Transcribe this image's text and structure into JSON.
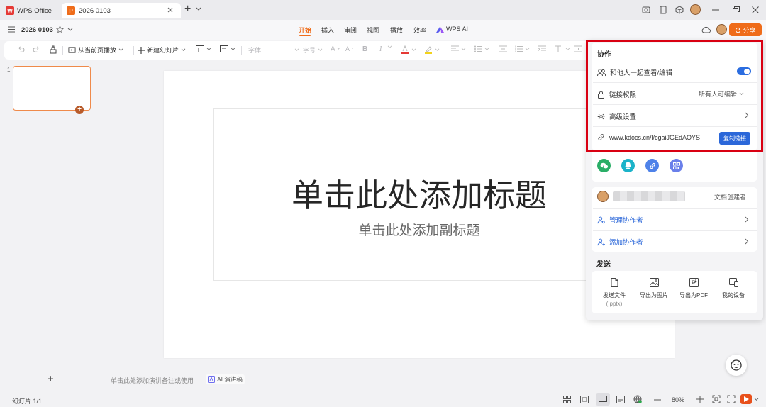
{
  "titlebar": {
    "app_tab": "WPS Office",
    "doc_tab": "2026 0103",
    "add_tab": "+",
    "app_logo": "W",
    "doc_logo": "P"
  },
  "menubar": {
    "doc_name": "2026 0103",
    "tabs": [
      "开始",
      "插入",
      "审阅",
      "视图",
      "播放",
      "效率",
      "WPS AI"
    ],
    "share_button": "分享"
  },
  "toolbar": {
    "play_from_current": "从当前页播放",
    "new_slide": "新建幻灯片",
    "font_placeholder": "字体",
    "font_size_placeholder": "字号"
  },
  "slides_panel": {
    "slide_number": "1",
    "add_slide": "+"
  },
  "slide": {
    "title_placeholder": "单击此处添加标题",
    "subtitle_placeholder": "单击此处添加副标题"
  },
  "notes": {
    "placeholder": "单击此处添加演讲备注或使用",
    "ai_button": "AI 演讲稿"
  },
  "statusbar": {
    "slide_counter": "幻灯片 1/1",
    "zoom": "80%"
  },
  "share_panel": {
    "collab_header": "协作",
    "co_edit_label": "和他人一起查看/编辑",
    "co_edit_enabled": true,
    "link_permission_label": "链接权限",
    "link_permission_value": "所有人可编辑",
    "advanced_settings": "高级设置",
    "link_url": "www.kdocs.cn/l/cgaiJGEdAOYS",
    "copy_link_button": "复制链接",
    "creator_role": "文档创建者",
    "manage_collaborators": "管理协作者",
    "add_collaborators": "添加协作者",
    "send_header": "发送",
    "send_file": "发送文件",
    "send_file_ext": "(.pptx)",
    "export_image": "导出为图片",
    "export_pdf": "导出为PDF",
    "my_devices": "我的设备"
  },
  "colors": {
    "accent": "#ef6c1a",
    "link_blue": "#2b67d9",
    "toggle_blue": "#2b6de0",
    "highlight_red": "#d90012"
  }
}
